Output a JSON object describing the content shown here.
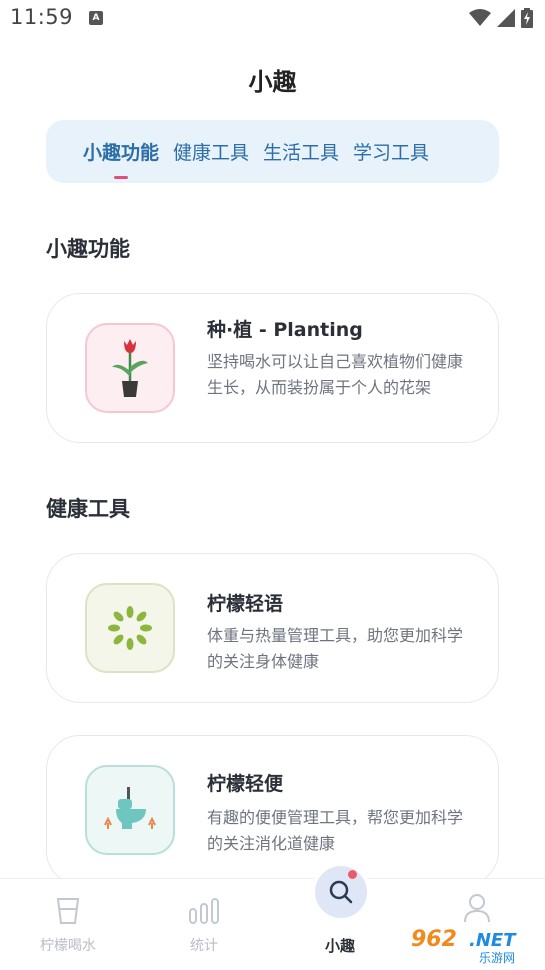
{
  "status": {
    "time": "11:59",
    "notif_glyph": "A"
  },
  "header": {
    "title": "小趣"
  },
  "tabs": [
    {
      "label": "小趣功能",
      "active": true
    },
    {
      "label": "健康工具",
      "active": false
    },
    {
      "label": "生活工具",
      "active": false
    },
    {
      "label": "学习工具",
      "active": false
    }
  ],
  "sections": [
    {
      "heading": "小趣功能",
      "cards": [
        {
          "title": "种·植 - Planting",
          "description": "坚持喝水可以让自己喜欢植物们健康生长，从而装扮属于个人的花架",
          "icon": "potted-tulip-icon",
          "icon_bg": "#fdeef2",
          "icon_border": "#f6c7d3"
        }
      ]
    },
    {
      "heading": "健康工具",
      "cards": [
        {
          "title": "柠檬轻语",
          "description": "体重与热量管理工具，助您更加科学的关注身体健康",
          "icon": "green-sparkle-icon",
          "icon_bg": "#f5f6ea",
          "icon_border": "#dde2c4"
        },
        {
          "title": "柠檬轻便",
          "description": "有趣的便便管理工具，帮您更加科学的关注消化道健康",
          "icon": "toilet-icon",
          "icon_bg": "#edf7f6",
          "icon_border": "#b9dfdb"
        }
      ]
    }
  ],
  "bottom_nav": [
    {
      "label": "柠檬喝水",
      "icon": "cup-icon",
      "active": false
    },
    {
      "label": "统计",
      "icon": "bar-chart-icon",
      "active": false
    },
    {
      "label": "小趣",
      "icon": "search-icon",
      "active": true
    },
    {
      "label": "我的",
      "icon": "user-icon",
      "active": false
    }
  ],
  "watermark": {
    "text_main": "962.NET",
    "text_sub": "乐游网"
  },
  "colors": {
    "accent": "#2c6ea8",
    "tab_bg": "#e8f2fb",
    "indicator": "#e2507a",
    "nav_active_bg": "#dfe7f6",
    "badge": "#ec5a6a"
  }
}
